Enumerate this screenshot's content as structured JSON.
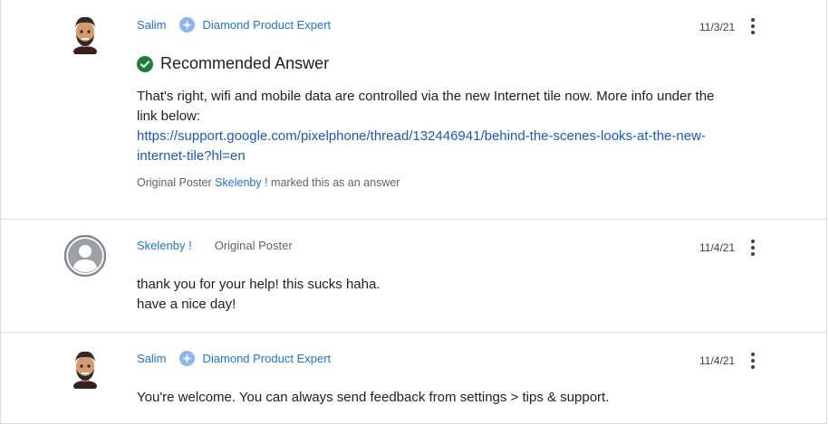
{
  "posts": [
    {
      "author": "Salim",
      "badge_label": "Diamond Product Expert",
      "date": "11/3/21",
      "recommended_label": "Recommended Answer",
      "body_line1": "That's right, wifi and mobile data are controlled via the new Internet tile now. More info under the",
      "body_line2": "link below:",
      "link_line1": "https://support.google.com/pixelphone/thread/132446941/behind-the-scenes-looks-at-the-new-",
      "link_line2": "internet-tile?hl=en",
      "marked_prefix": "Original Poster",
      "marked_name": "Skelenby !",
      "marked_suffix": "marked this as an answer"
    },
    {
      "author": "Skelenby !",
      "op_label": "Original Poster",
      "date": "11/4/21",
      "body_line1": "thank you for your help! this sucks haha.",
      "body_line2": "have a nice day!"
    },
    {
      "author": "Salim",
      "badge_label": "Diamond Product Expert",
      "date": "11/4/21",
      "body_line1": "You're welcome. You can always send feedback from settings > tips & support."
    }
  ],
  "icons": {
    "avatar_expert": "memoji-avatar-icon",
    "avatar_default": "default-user-avatar-icon",
    "badge": "diamond-expert-badge-icon",
    "check": "check-circle-icon",
    "more": "more-vert-icon"
  },
  "colors": {
    "link": "#1a73e8",
    "check_green": "#188038",
    "divider": "#dadce0",
    "muted": "#5f6368"
  }
}
